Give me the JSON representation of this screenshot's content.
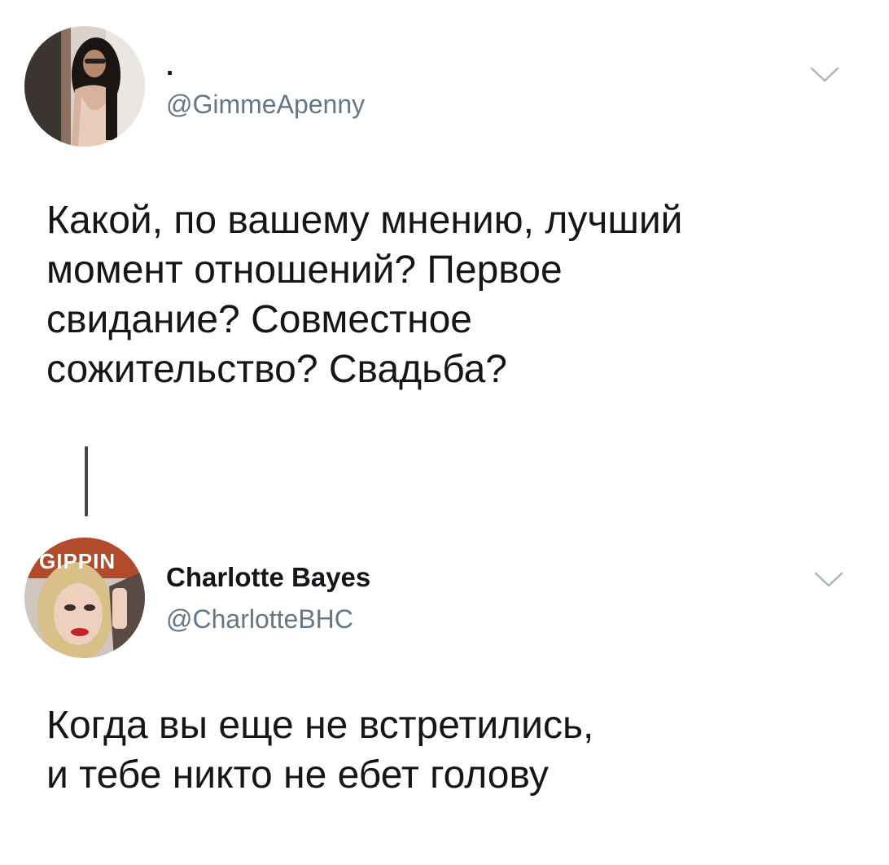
{
  "tweets": [
    {
      "display_name": ".",
      "handle": "@GimmeApenny",
      "text": "Какой, по вашему мнению, лучший\nмомент отношений? Первое\nсвидание? Совместное\nсожительство? Свадьба?",
      "avatar_icon": "user-avatar-photo",
      "menu_icon": "chevron-down-icon"
    },
    {
      "display_name": "Charlotte Bayes",
      "handle": "@CharlotteBHC",
      "avatar_overlay_text": "GIPPIN",
      "text": "Когда вы еще не встретились,\nи тебе никто не ебет голову",
      "avatar_icon": "user-avatar-photo",
      "menu_icon": "chevron-down-icon"
    }
  ],
  "colors": {
    "text": "#14171a",
    "secondary_text": "#657786",
    "chevron": "#aab8c2",
    "thread_line": "#444a4f"
  }
}
